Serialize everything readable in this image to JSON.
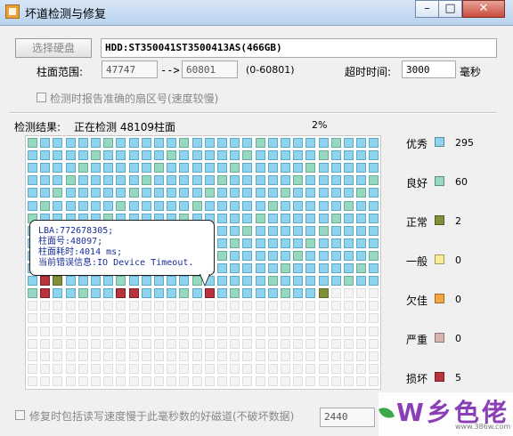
{
  "window": {
    "title": "坏道检测与修复",
    "min_label": "–",
    "max_label": "□",
    "close_label": "✕"
  },
  "toolbar": {
    "select_disk_label": "选择硬盘",
    "disk_info": "HDD:ST350041ST3500413AS(466GB)"
  },
  "range": {
    "label": "柱面范围:",
    "start": "47747",
    "arrow": "-->",
    "end": "60801",
    "total": "(0-60801)"
  },
  "timeout": {
    "label": "超时时间:",
    "value": "3000",
    "unit": "毫秒"
  },
  "options": {
    "report_sector": "检测时报告准确的扇区号(速度较慢)",
    "repair_option": "修复时包括读写速度慢于此毫秒数的好磁道(不破坏数据)",
    "repair_ms": "2440"
  },
  "status": {
    "label": "检测结果:",
    "text": "正在检测 48109柱面",
    "percent": "2%"
  },
  "legend": [
    {
      "label": "优秀",
      "count": "295",
      "color": "#8ed4ee"
    },
    {
      "label": "良好",
      "count": "60",
      "color": "#97d8c2"
    },
    {
      "label": "正常",
      "count": "2",
      "color": "#7f8f3a"
    },
    {
      "label": "一般",
      "count": "0",
      "color": "#fbec96"
    },
    {
      "label": "欠佳",
      "count": "0",
      "color": "#f4a641"
    },
    {
      "label": "严重",
      "count": "0",
      "color": "#d8b5b1"
    },
    {
      "label": "损坏",
      "count": "5",
      "color": "#b8343d"
    }
  ],
  "tooltip": {
    "lba": "LBA:772678305;",
    "cylinder": "柱面号:48097;",
    "elapsed": "柱面耗时:4014 ms;",
    "error": "当前错误信息:IO Device Timeout."
  },
  "watermark": {
    "text": "W乡色佬",
    "url": "www.386w.com"
  }
}
